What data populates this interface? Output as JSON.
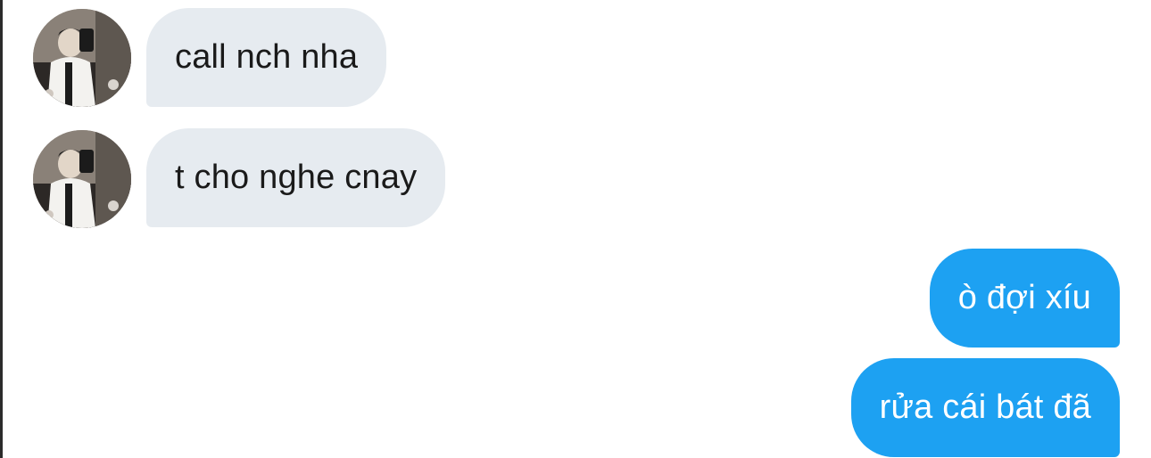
{
  "messages": [
    {
      "direction": "incoming",
      "text": "call nch nha"
    },
    {
      "direction": "incoming",
      "text": "t cho nghe cnay"
    },
    {
      "direction": "outgoing",
      "text": "ò đợi xíu"
    },
    {
      "direction": "outgoing",
      "text": "rửa cái bát đã"
    }
  ],
  "colors": {
    "incoming_bubble": "#e6ebf0",
    "outgoing_bubble": "#1da1f2",
    "incoming_text": "#1a1a1a",
    "outgoing_text": "#ffffff"
  },
  "icons": {
    "avatar": "contact-avatar-photo"
  }
}
